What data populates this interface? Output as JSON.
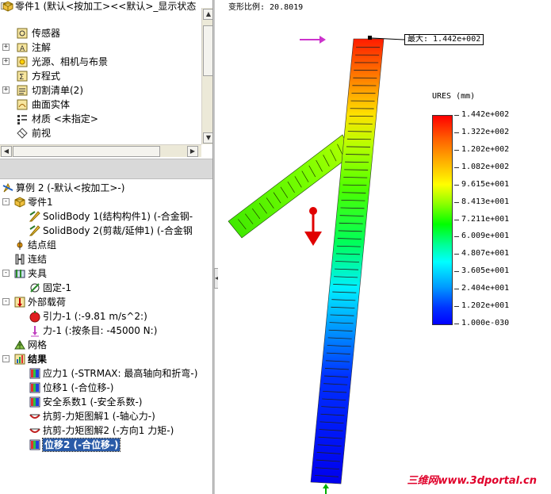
{
  "feature_tree": {
    "rows": [
      {
        "name": "part-root",
        "label": "零件1  (默认<按加工><<默认>_显示状态",
        "icon": "part-icon",
        "expander": "-"
      },
      {
        "name": "sensors",
        "label": "传感器",
        "icon": "sensor-icon",
        "expander": ""
      },
      {
        "name": "annotations",
        "label": "注解",
        "icon": "annotation-icon",
        "expander": "+"
      },
      {
        "name": "lights-cameras",
        "label": "光源、相机与布景",
        "icon": "lights-icon",
        "expander": "+"
      },
      {
        "name": "equations",
        "label": "方程式",
        "icon": "equation-icon",
        "expander": ""
      },
      {
        "name": "cut-list",
        "label": "切割清单(2)",
        "icon": "cut-list-icon",
        "expander": "+"
      },
      {
        "name": "surface-bodies",
        "label": "曲面实体",
        "icon": "surface-body-icon",
        "expander": ""
      },
      {
        "name": "material",
        "label": "材质 <未指定>",
        "icon": "material-icon",
        "expander": ""
      },
      {
        "name": "front-plane",
        "label": "前视",
        "icon": "plane-icon",
        "expander": ""
      }
    ]
  },
  "simulation_tree": {
    "rows": [
      {
        "name": "study",
        "label": "算例 2 (-默认<按加工>-)",
        "icon": "study-icon",
        "expander": "",
        "bold": false
      },
      {
        "name": "parts",
        "label": "零件1",
        "icon": "part-icon",
        "expander": "-",
        "bold": false
      },
      {
        "name": "solidbody-1",
        "label": "SolidBody 1(结构构件1) (-合金钢-",
        "icon": "beam-body-icon",
        "expander": "",
        "bold": false
      },
      {
        "name": "solidbody-2",
        "label": "SolidBody 2(剪裁/延伸1) (-合金钢",
        "icon": "beam-body-icon",
        "expander": "",
        "bold": false
      },
      {
        "name": "joint-group",
        "label": "结点组",
        "icon": "joint-group-icon",
        "expander": "",
        "bold": false
      },
      {
        "name": "connections",
        "label": "连结",
        "icon": "connection-icon",
        "expander": "",
        "bold": false
      },
      {
        "name": "fixtures",
        "label": "夹具",
        "icon": "fixture-icon",
        "expander": "-",
        "bold": false
      },
      {
        "name": "fixed-1",
        "label": "固定-1",
        "icon": "fixed-icon",
        "expander": "",
        "bold": false
      },
      {
        "name": "external-loads",
        "label": "外部载荷",
        "icon": "load-icon",
        "expander": "-",
        "bold": false
      },
      {
        "name": "gravity-1",
        "label": "引力-1 (:-9.81 m/s^2:)",
        "icon": "gravity-icon",
        "expander": "",
        "bold": false
      },
      {
        "name": "force-1",
        "label": "力-1 (:按条目: -45000 N:)",
        "icon": "force-icon",
        "expander": "",
        "bold": false
      },
      {
        "name": "mesh",
        "label": "网格",
        "icon": "mesh-icon",
        "expander": "",
        "bold": false
      },
      {
        "name": "results",
        "label": "结果",
        "icon": "results-icon",
        "expander": "-",
        "bold": true
      },
      {
        "name": "stress-1",
        "label": "应力1 (-STRMAX: 最高轴向和折弯-)",
        "icon": "stress-plot-icon",
        "expander": "",
        "bold": false
      },
      {
        "name": "displacement-1",
        "label": "位移1 (-合位移-)",
        "icon": "displacement-plot-icon",
        "expander": "",
        "bold": false
      },
      {
        "name": "factor-of-safety-1",
        "label": "安全系数1 (-安全系数-)",
        "icon": "fos-plot-icon",
        "expander": "",
        "bold": false
      },
      {
        "name": "shear-moment-1",
        "label": "抗剪-力矩图解1 (-轴心力-)",
        "icon": "beam-diagram-icon",
        "expander": "",
        "bold": false
      },
      {
        "name": "shear-moment-2",
        "label": "抗剪-力矩图解2 (-方向1 力矩-)",
        "icon": "beam-diagram-icon",
        "expander": "",
        "bold": false
      },
      {
        "name": "displacement-2",
        "label": "位移2 (-合位移-)",
        "icon": "displacement-plot-icon",
        "expander": "",
        "bold": true,
        "selected": true
      }
    ]
  },
  "viewport": {
    "deformation_scale_text": "变形比例: 20.8019",
    "max_label_text": "最大:  1.442e+002",
    "legend_title": "URES (mm)",
    "legend_values": [
      "1.442e+002",
      "1.322e+002",
      "1.202e+002",
      "1.082e+002",
      "9.615e+001",
      "8.413e+001",
      "7.211e+001",
      "6.009e+001",
      "4.807e+001",
      "3.605e+001",
      "2.404e+001",
      "1.202e+001",
      "1.000e-030"
    ],
    "watermark": "三维网www.3dportal.cn",
    "colors": {
      "max": "#ff0000",
      "min": "#0000ff",
      "load_arrow": "#e00000",
      "max_pointer": "#cc33cc",
      "fixture_arrow": "#00b000",
      "selection": "#2a5ba8"
    }
  }
}
